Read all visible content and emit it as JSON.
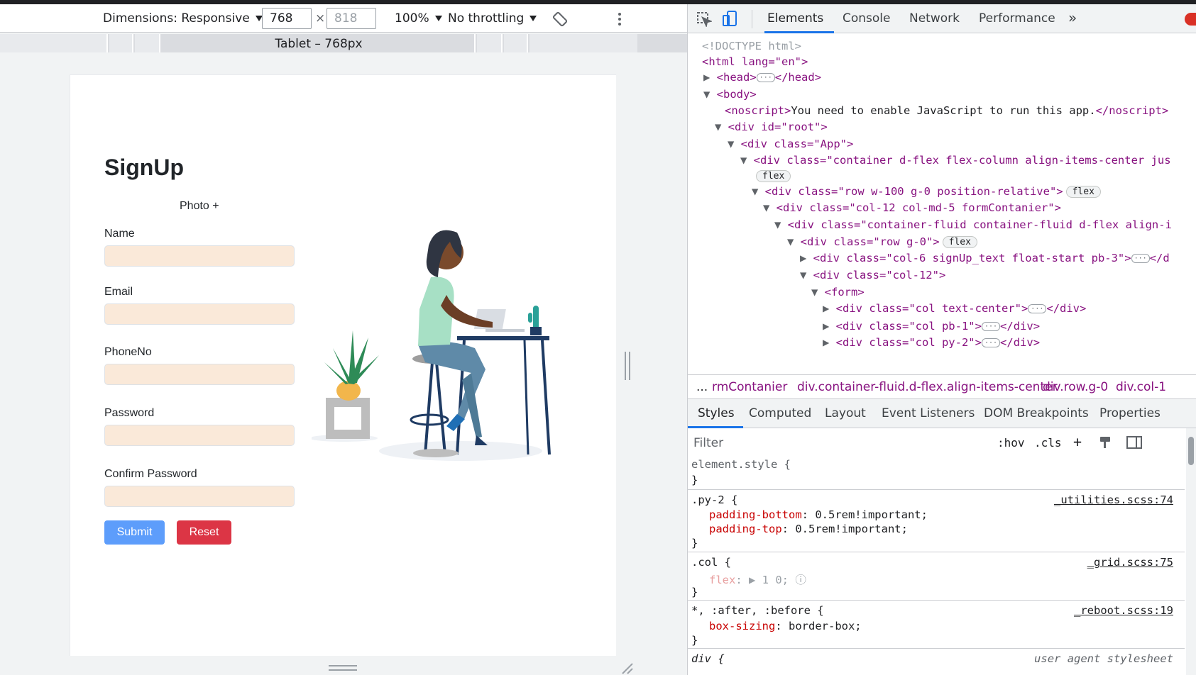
{
  "device_toolbar": {
    "dimensions_label": "Dimensions: Responsive",
    "width_value": "768",
    "times": "×",
    "height_placeholder": "818",
    "zoom": "100%",
    "throttling": "No throttling",
    "ruler_label": "Tablet – 768px"
  },
  "app": {
    "title": "SignUp",
    "photo_label": "Photo +",
    "fields": [
      "Name",
      "Email",
      "PhoneNo",
      "Password",
      "Confirm Password"
    ],
    "submit_label": "Submit",
    "reset_label": "Reset"
  },
  "devtools": {
    "tabs": [
      "Elements",
      "Console",
      "Network",
      "Performance"
    ],
    "more": "»",
    "dom": {
      "doctype": "<!DOCTYPE html>",
      "html_open": "<html lang=\"en\">",
      "head": "<head>",
      "head_close": "</head>",
      "body": "<body>",
      "noscript_open": "<noscript>",
      "noscript_text": "You need to enable JavaScript to run this app.",
      "noscript_close": "</noscript>",
      "root": "<div id=\"root\">",
      "app_div": "<div class=\"App\">",
      "container": "<div class=\"container d-flex flex-column align-items-center jus",
      "flex_pill": "flex",
      "row": "<div class=\"row w-100 g-0 position-relative\">",
      "col12": "<div class=\"col-12 col-md-5 formContanier\">",
      "fluid": "<div class=\"container-fluid container-fluid d-flex align-i",
      "rowg0": "<div class=\"row g-0\">",
      "signup_text": "<div class=\"col-6 signUp_text float-start pb-3\">",
      "signup_close": "</d",
      "col12b": "<div class=\"col-12\">",
      "form": "<form>",
      "col_center": "<div class=\"col text-center\">",
      "col_pb1": "<div class=\"col pb-1\">",
      "col_py2": "<div class=\"col py-2\">",
      "div_close": "</div>"
    },
    "breadcrumbs": [
      "...",
      "rmContanier",
      "div.container-fluid.d-flex.align-items-center",
      "div.row.g-0",
      "div.col-1"
    ],
    "style_tabs": [
      "Styles",
      "Computed",
      "Layout",
      "Event Listeners",
      "DOM Breakpoints",
      "Properties"
    ],
    "filter_placeholder": "Filter",
    "hov": ":hov",
    "cls": ".cls",
    "rules": {
      "element_style": "element.style {",
      "close": "}",
      "py2_sel": ".py-2 {",
      "py2_src": "_utilities.scss:74",
      "pb_prop": "padding-bottom",
      "pb_val": ": 0.5rem!important;",
      "pt_prop": "padding-top",
      "pt_val": ": 0.5rem!important;",
      "col_sel": ".col {",
      "col_src": "_grid.scss:75",
      "flex_prop": "flex",
      "flex_val": ": ▶ 1 0;",
      "star_sel": "*, :after, :before {",
      "star_src": "_reboot.scss:19",
      "bs_prop": "box-sizing",
      "bs_val": ": border-box;",
      "div_sel": "div {",
      "div_src": "user agent stylesheet"
    }
  }
}
